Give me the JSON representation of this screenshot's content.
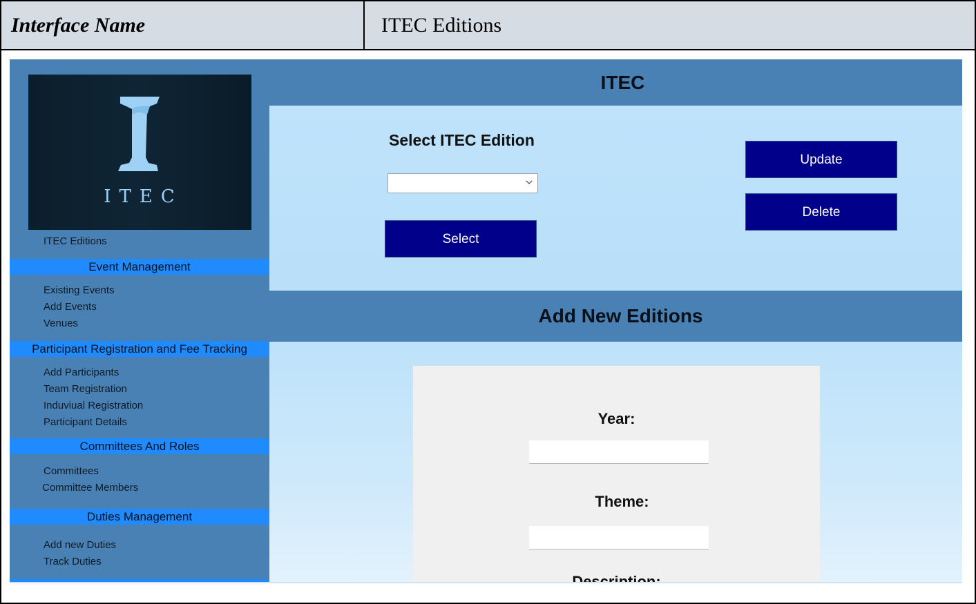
{
  "header": {
    "label": "Interface Name",
    "value": "ITEC Editions"
  },
  "logo": {
    "word": "ITEC"
  },
  "sidebar": {
    "top_link": "ITEC Editions",
    "sections": [
      {
        "title": "Event Management",
        "items": [
          "Existing Events",
          "Add Events",
          "Venues"
        ]
      },
      {
        "title": "Participant Registration and Fee Tracking",
        "items": [
          "Add Participants",
          "Team Registration",
          "Induviual Registration",
          "Participant Details"
        ]
      },
      {
        "title": "Committees And Roles",
        "items": [
          "Committees",
          "Committee Members"
        ]
      },
      {
        "title": "Duties Management",
        "items": [
          "Add new Duties",
          "Track Duties"
        ]
      }
    ]
  },
  "main": {
    "title": "ITEC",
    "select_heading": "Select ITEC Edition",
    "dropdown_value": "",
    "select_button": "Select",
    "update_button": "Update",
    "delete_button": "Delete",
    "add_title": "Add New Editions",
    "form": {
      "year_label": "Year:",
      "year_value": "",
      "theme_label": "Theme:",
      "theme_value": "",
      "description_label": "Description:"
    }
  },
  "colors": {
    "app_blue": "#4a81b4",
    "section_blue": "#1f8bff",
    "button_navy": "#00008b",
    "panel_light": "#bfe3fb"
  }
}
